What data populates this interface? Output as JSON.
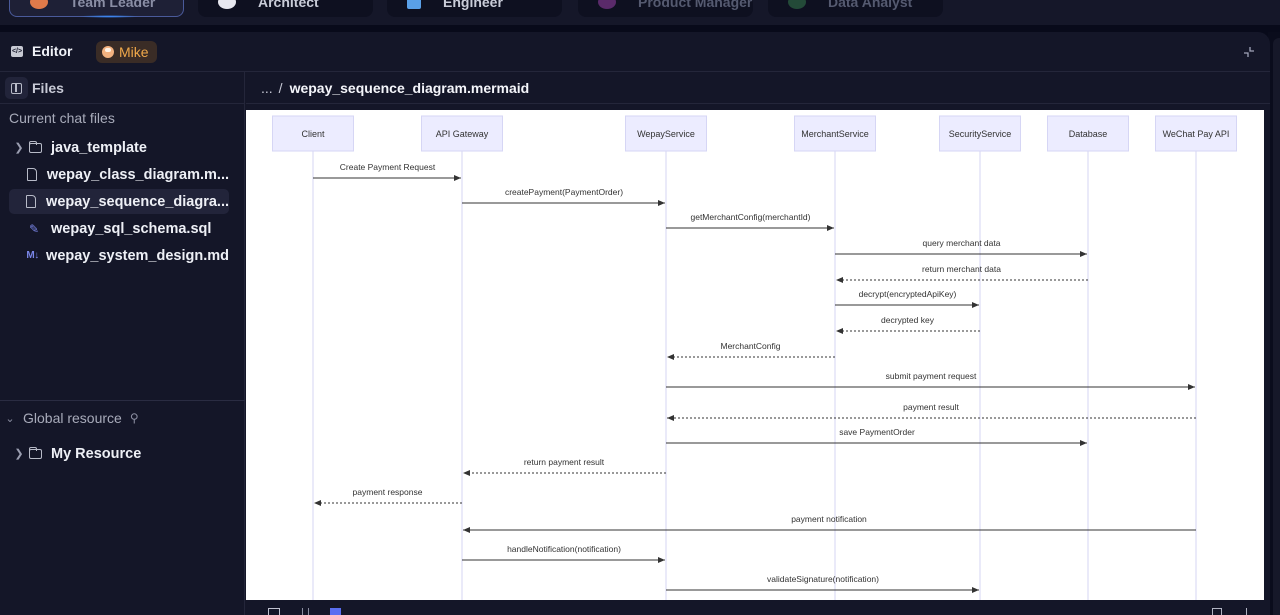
{
  "roles": [
    {
      "label": "Team Leader",
      "active": true,
      "icon": "team-leader-icon",
      "color": "#e07a4a"
    },
    {
      "label": "Architect",
      "active": false,
      "icon": "architect-icon",
      "color": "#e8e8f0"
    },
    {
      "label": "Engineer",
      "active": false,
      "icon": "engineer-icon",
      "color": "#5aa0e8"
    },
    {
      "label": "Product Manager",
      "active": false,
      "icon": "product-manager-icon",
      "color": "#7a3a8a"
    },
    {
      "label": "Data Analyst",
      "active": false,
      "icon": "data-analyst-icon",
      "color": "#2a6a4a"
    }
  ],
  "editor": {
    "title": "Editor",
    "user": "Mike",
    "collapse_icon": "collapse-icon"
  },
  "sidebar": {
    "files_label": "Files",
    "current_section": "Current chat files",
    "items": [
      {
        "label": "java_template",
        "type": "folder",
        "expandable": true,
        "selected": false
      },
      {
        "label": "wepay_class_diagram.m...",
        "type": "file",
        "expandable": false,
        "selected": false
      },
      {
        "label": "wepay_sequence_diagra...",
        "type": "file",
        "expandable": false,
        "selected": true
      },
      {
        "label": "wepay_sql_schema.sql",
        "type": "sql",
        "expandable": false,
        "selected": false
      },
      {
        "label": "wepay_system_design.md",
        "type": "md",
        "expandable": false,
        "selected": false
      }
    ],
    "global_section": "Global resource",
    "global_items": [
      {
        "label": "My Resource",
        "type": "folder",
        "expandable": true
      }
    ]
  },
  "breadcrumb": {
    "ellipsis": "...",
    "separator": "/",
    "file": "wepay_sequence_diagram.mermaid"
  },
  "diagram": {
    "participants": [
      "Client",
      "API Gateway",
      "WepayService",
      "MerchantService",
      "SecurityService",
      "Database",
      "WeChat Pay API"
    ],
    "messages": [
      {
        "from": "Client",
        "to": "API Gateway",
        "label": "Create Payment Request",
        "style": "solid"
      },
      {
        "from": "API Gateway",
        "to": "WepayService",
        "label": "createPayment(PaymentOrder)",
        "style": "solid"
      },
      {
        "from": "WepayService",
        "to": "MerchantService",
        "label": "getMerchantConfig(merchantId)",
        "style": "solid"
      },
      {
        "from": "MerchantService",
        "to": "Database",
        "label": "query merchant data",
        "style": "solid"
      },
      {
        "from": "Database",
        "to": "MerchantService",
        "label": "return merchant data",
        "style": "dotted"
      },
      {
        "from": "MerchantService",
        "to": "SecurityService",
        "label": "decrypt(encryptedApiKey)",
        "style": "solid"
      },
      {
        "from": "SecurityService",
        "to": "MerchantService",
        "label": "decrypted key",
        "style": "dotted"
      },
      {
        "from": "MerchantService",
        "to": "WepayService",
        "label": "MerchantConfig",
        "style": "dotted"
      },
      {
        "from": "WepayService",
        "to": "WeChat Pay API",
        "label": "submit payment request",
        "style": "solid"
      },
      {
        "from": "WeChat Pay API",
        "to": "WepayService",
        "label": "payment result",
        "style": "dotted"
      },
      {
        "from": "WepayService",
        "to": "Database",
        "label": "save PaymentOrder",
        "style": "solid"
      },
      {
        "from": "WepayService",
        "to": "API Gateway",
        "label": "return payment result",
        "style": "dotted"
      },
      {
        "from": "API Gateway",
        "to": "Client",
        "label": "payment response",
        "style": "dotted"
      },
      {
        "from": "WeChat Pay API",
        "to": "API Gateway",
        "label": "payment notification",
        "style": "solid"
      },
      {
        "from": "API Gateway",
        "to": "WepayService",
        "label": "handleNotification(notification)",
        "style": "solid"
      },
      {
        "from": "WepayService",
        "to": "SecurityService",
        "label": "validateSignature(notification)",
        "style": "solid"
      }
    ]
  },
  "colors": {
    "accent": "#3a8cff",
    "actor_fill": "#ececff",
    "actor_stroke": "#d6d6f5",
    "lifeline": "#dcdcf5",
    "message": "#333333",
    "user_chip_text": "#f0a84a"
  }
}
